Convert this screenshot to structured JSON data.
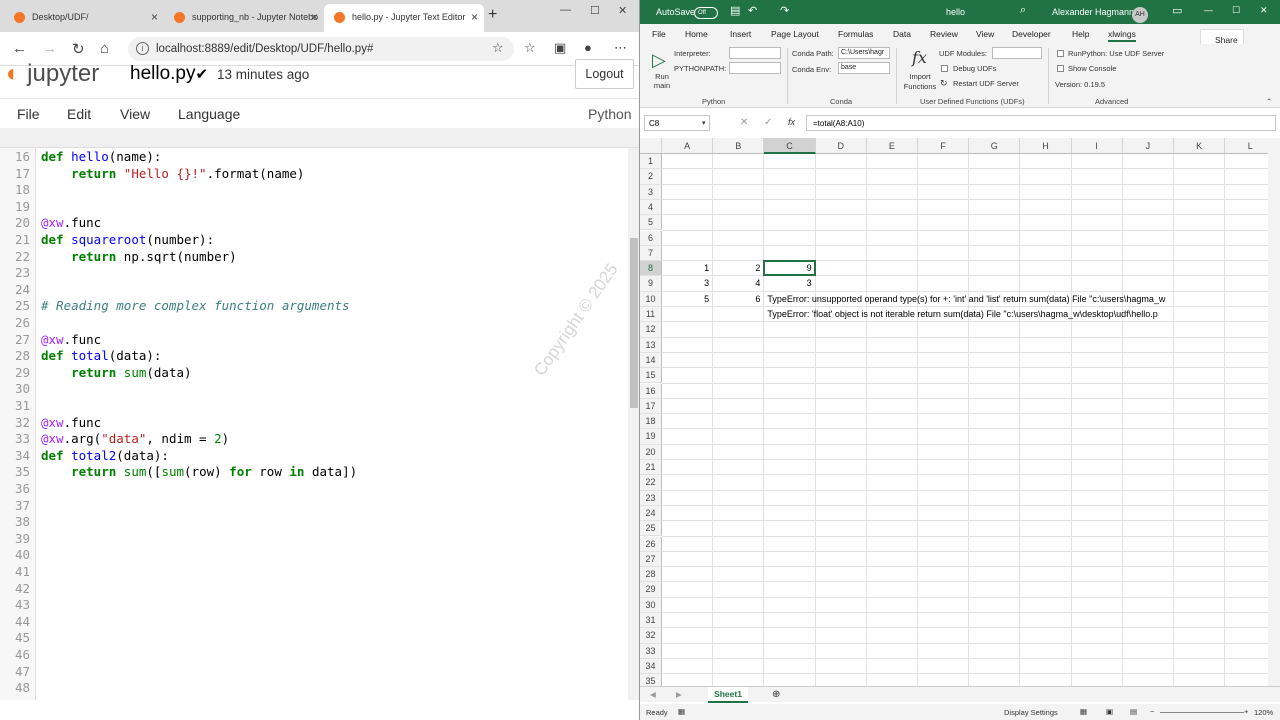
{
  "browser": {
    "tabs": [
      {
        "title": "Desktop/UDF/",
        "fav_color": "#f37726"
      },
      {
        "title": "supporting_nb - Jupyter Notebo",
        "fav_color": "#f37726"
      },
      {
        "title": "hello.py - Jupyter Text Editor",
        "fav_color": "#f37726"
      }
    ],
    "url": "localhost:8889/edit/Desktop/UDF/hello.py#"
  },
  "jupyter": {
    "logo": "jupyter",
    "filename": "hello.py",
    "saved_mark": "✔",
    "saved": "13 minutes ago",
    "logout": "Logout",
    "menu": [
      "File",
      "Edit",
      "View",
      "Language"
    ],
    "language": "Python"
  },
  "code_lines": [
    {
      "n": "16",
      "html": "<span class='kw'>def</span> <span class='fn'>hello</span>(name):"
    },
    {
      "n": "17",
      "html": "    <span class='kw'>return</span> <span class='st'>\"Hello {}!\"</span>.format(name)"
    },
    {
      "n": "18",
      "html": ""
    },
    {
      "n": "19",
      "html": ""
    },
    {
      "n": "20",
      "html": "<span class='dc'>@xw</span>.func"
    },
    {
      "n": "21",
      "html": "<span class='kw'>def</span> <span class='fn'>squareroot</span>(number):"
    },
    {
      "n": "22",
      "html": "    <span class='kw'>return</span> np.sqrt(number)"
    },
    {
      "n": "23",
      "html": ""
    },
    {
      "n": "24",
      "html": ""
    },
    {
      "n": "25",
      "html": "<span class='cm'># Reading more complex function arguments</span>"
    },
    {
      "n": "26",
      "html": ""
    },
    {
      "n": "27",
      "html": "<span class='dc'>@xw</span>.func"
    },
    {
      "n": "28",
      "html": "<span class='kw'>def</span> <span class='fn'>total</span>(data):"
    },
    {
      "n": "29",
      "html": "    <span class='kw'>return</span> <span class='kw' style='font-weight:normal'>sum</span>(data)"
    },
    {
      "n": "30",
      "html": ""
    },
    {
      "n": "31",
      "html": ""
    },
    {
      "n": "32",
      "html": "<span class='dc'>@xw</span>.func"
    },
    {
      "n": "33",
      "html": "<span class='dc'>@xw</span>.arg(<span class='st'>\"data\"</span>, ndim = <span class='nm'>2</span>)"
    },
    {
      "n": "34",
      "html": "<span class='kw'>def</span> <span class='fn'>total2</span>(data):"
    },
    {
      "n": "35",
      "html": "    <span class='kw'>return</span> <span class='kw' style='font-weight:normal'>sum</span>([<span class='kw' style='font-weight:normal'>sum</span>(row) <span class='kw'>for</span> row <span class='kw'>in</span> data])"
    },
    {
      "n": "36",
      "html": ""
    },
    {
      "n": "37",
      "html": ""
    },
    {
      "n": "38",
      "html": ""
    },
    {
      "n": "39",
      "html": ""
    },
    {
      "n": "40",
      "html": ""
    },
    {
      "n": "41",
      "html": ""
    },
    {
      "n": "42",
      "html": ""
    },
    {
      "n": "43",
      "html": ""
    },
    {
      "n": "44",
      "html": ""
    },
    {
      "n": "45",
      "html": ""
    },
    {
      "n": "46",
      "html": ""
    },
    {
      "n": "47",
      "html": ""
    },
    {
      "n": "48",
      "html": ""
    }
  ],
  "watermark": "Copyright © 2025",
  "excel": {
    "autosave": "AutoSave",
    "autosave_state": "Off",
    "doc": "hello",
    "user": "Alexander Hagmann",
    "initials": "AH",
    "tabs": [
      "File",
      "Home",
      "Insert",
      "Page Layout",
      "Formulas",
      "Data",
      "Review",
      "View",
      "Developer",
      "Help",
      "xlwings"
    ],
    "share": "Share",
    "ribbon": {
      "run_main": "Run main",
      "interpreter": "Interpreter:",
      "pythonpath": "PYTHONPATH:",
      "conda_path": "Conda Path:",
      "conda_path_val": "C:\\Users\\hagr",
      "conda_env": "Conda Env:",
      "conda_env_val": "base",
      "import_functions": "Import Functions",
      "udf_modules": "UDF Modules:",
      "debug_udfs": "Debug UDFs",
      "restart_udf": "Restart UDF Server",
      "runpython": "RunPython: Use UDF Server",
      "show_console": "Show Console",
      "version": "Version: 0.19.5",
      "groups": [
        "Python",
        "Conda",
        "User Defined Functions (UDFs)",
        "Advanced"
      ]
    },
    "namebox": "C8",
    "formula": "=total(A8:A10)",
    "columns": [
      "A",
      "B",
      "C",
      "D",
      "E",
      "F",
      "G",
      "H",
      "I",
      "J",
      "K",
      "L"
    ],
    "rows": [
      "1",
      "2",
      "3",
      "4",
      "5",
      "6",
      "7",
      "8",
      "9",
      "10",
      "11",
      "12",
      "13",
      "14",
      "15",
      "16",
      "17",
      "18",
      "19",
      "20",
      "21",
      "22",
      "23",
      "24",
      "25",
      "26",
      "27",
      "28",
      "29",
      "30",
      "31",
      "32",
      "33",
      "34",
      "35"
    ],
    "cells": {
      "A8": "1",
      "B8": "2",
      "C8": "9",
      "A9": "3",
      "B9": "4",
      "C9": "3",
      "A10": "5",
      "B10": "6",
      "C10": "TypeError: unsupported operand type(s) for +: 'int' and 'list'    return sum(data)  File \"c:\\users\\hagma_w",
      "C11": "TypeError: 'float' object is not iterable    return sum(data)  File \"c:\\users\\hagma_w\\desktop\\udf\\hello.p"
    },
    "sheet": "Sheet1",
    "status": "Ready",
    "display_settings": "Display Settings",
    "zoom": "120%"
  }
}
